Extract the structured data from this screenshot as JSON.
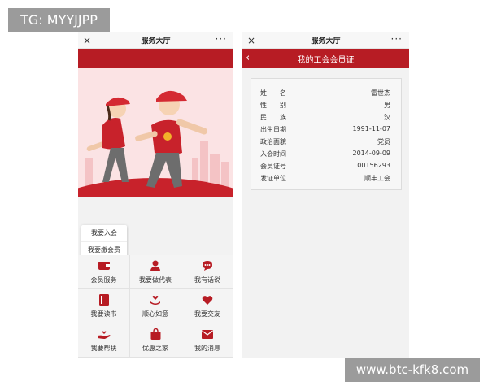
{
  "watermarks": {
    "top": "TG: MYYJJPP",
    "bottom": "www.btc-kfk8.com"
  },
  "left_phone": {
    "title": "服务大厅",
    "close_icon": "×",
    "more_icon": "···",
    "popup": [
      "我要入会",
      "我要缴会费"
    ],
    "grid": [
      {
        "label": "会员服务",
        "icon": "wallet-icon"
      },
      {
        "label": "我要做代表",
        "icon": "user-icon"
      },
      {
        "label": "我有话说",
        "icon": "chat-icon"
      },
      {
        "label": "我要读书",
        "icon": "book-icon"
      },
      {
        "label": "顺心如意",
        "icon": "heart-hand-icon"
      },
      {
        "label": "我要交友",
        "icon": "heart-icon"
      },
      {
        "label": "我要帮扶",
        "icon": "hand-help-icon"
      },
      {
        "label": "优惠之家",
        "icon": "bag-icon"
      },
      {
        "label": "我的消息",
        "icon": "mail-icon"
      }
    ]
  },
  "right_phone": {
    "title": "服务大厅",
    "close_icon": "×",
    "more_icon": "···",
    "back_icon": "‹",
    "header": "我的工会会员证",
    "rows": [
      {
        "key": "姓　　名",
        "value": "雷世杰"
      },
      {
        "key": "性　　别",
        "value": "男"
      },
      {
        "key": "民　　族",
        "value": "汉"
      },
      {
        "key": "出生日期",
        "value": "1991-11-07"
      },
      {
        "key": "政治面貌",
        "value": "党员"
      },
      {
        "key": "入会时间",
        "value": "2014-09-09"
      },
      {
        "key": "会员证号",
        "value": "00156293"
      },
      {
        "key": "发证单位",
        "value": "顺丰工会"
      }
    ]
  },
  "colors": {
    "brand_red": "#b71c24",
    "panel_bg": "#f2f2f2"
  }
}
